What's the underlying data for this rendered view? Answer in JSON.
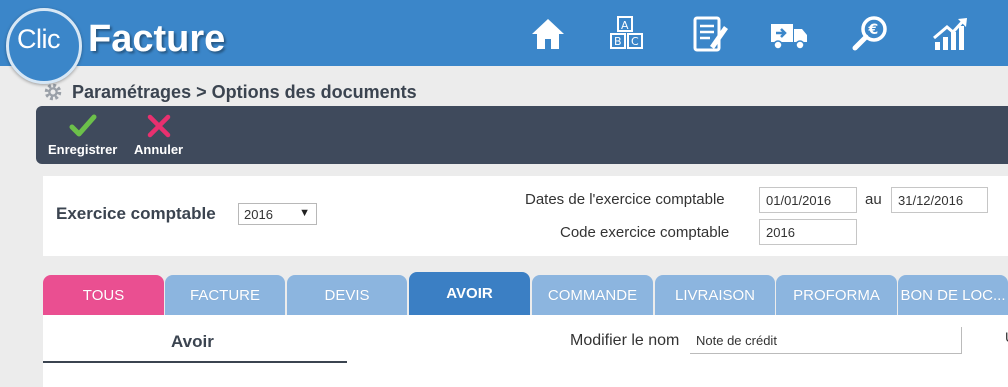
{
  "header": {
    "logo_clic": "Clic",
    "logo_facture": "Facture",
    "nav": [
      {
        "name": "home-icon"
      },
      {
        "name": "abc-blocks-icon"
      },
      {
        "name": "edit-document-icon"
      },
      {
        "name": "delivery-truck-icon"
      },
      {
        "name": "euro-search-icon"
      },
      {
        "name": "growth-chart-icon"
      }
    ]
  },
  "breadcrumb": {
    "text": "Paramétrages > Options des documents",
    "icon": "gear-icon"
  },
  "toolbar": {
    "save_label": "Enregistrer",
    "cancel_label": "Annuler"
  },
  "exercise": {
    "label": "Exercice comptable",
    "selected": "2016",
    "dates_label": "Dates de l'exercice comptable",
    "date_start": "01/01/2016",
    "au_label": "au",
    "date_end": "31/12/2016",
    "code_label": "Code exercice comptable",
    "code_value": "2016"
  },
  "tabs": [
    {
      "label": "TOUS"
    },
    {
      "label": "FACTURE"
    },
    {
      "label": "DEVIS"
    },
    {
      "label": "AVOIR"
    },
    {
      "label": "COMMANDE"
    },
    {
      "label": "LIVRAISON"
    },
    {
      "label": "PROFORMA"
    },
    {
      "label": "BON DE LOC..."
    }
  ],
  "content": {
    "title": "Avoir",
    "rename_label": "Modifier le nom",
    "rename_value": "Note de crédit",
    "cut_text": "U"
  },
  "colors": {
    "header": "#3b86c9",
    "toolbar": "#3f4a5c",
    "tab_tous": "#ea4f91",
    "tab_normal": "#8cb5df",
    "tab_active": "#3b7fc4",
    "save_check": "#6cc04a",
    "cancel_x": "#e9306f"
  }
}
